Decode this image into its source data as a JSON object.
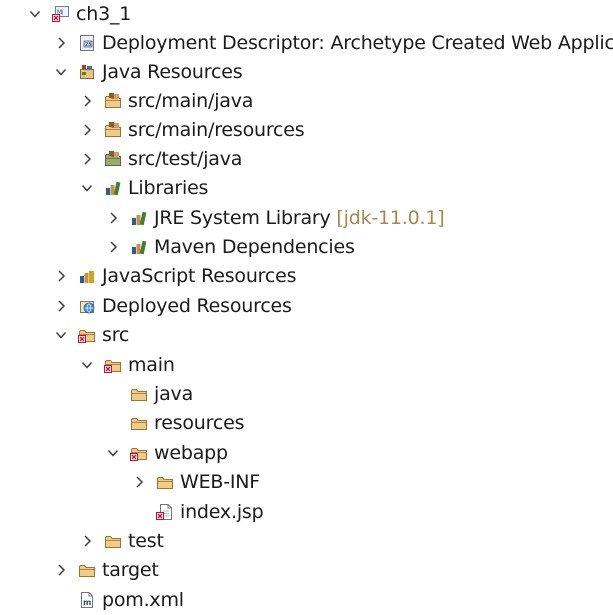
{
  "project_explorer": {
    "items": [
      {
        "label": "ch3_1",
        "suffix": "",
        "icon": "web-project-icon",
        "expanded": true
      },
      {
        "label": "Deployment Descriptor: Archetype Created Web Application",
        "suffix": "",
        "icon": "deployment-descriptor-icon",
        "expanded": false
      },
      {
        "label": "Java Resources",
        "suffix": "",
        "icon": "java-resources-icon",
        "expanded": true
      },
      {
        "label": "src/main/java",
        "suffix": "",
        "icon": "source-folder-icon",
        "expanded": false
      },
      {
        "label": "src/main/resources",
        "suffix": "",
        "icon": "source-folder-icon",
        "expanded": false
      },
      {
        "label": "src/test/java",
        "suffix": "",
        "icon": "test-source-folder-icon",
        "expanded": false
      },
      {
        "label": "Libraries",
        "suffix": "",
        "icon": "libraries-icon",
        "expanded": true
      },
      {
        "label": "JRE System Library",
        "suffix": "[jdk-11.0.1]",
        "icon": "library-icon",
        "expanded": false
      },
      {
        "label": "Maven Dependencies",
        "suffix": "",
        "icon": "library-icon",
        "expanded": false
      },
      {
        "label": "JavaScript Resources",
        "suffix": "",
        "icon": "javascript-resources-icon",
        "expanded": false
      },
      {
        "label": "Deployed Resources",
        "suffix": "",
        "icon": "deployed-resources-icon",
        "expanded": false
      },
      {
        "label": "src",
        "suffix": "",
        "icon": "folder-error-icon",
        "expanded": true
      },
      {
        "label": "main",
        "suffix": "",
        "icon": "folder-error-icon",
        "expanded": true
      },
      {
        "label": "java",
        "suffix": "",
        "icon": "folder-icon",
        "expanded": null
      },
      {
        "label": "resources",
        "suffix": "",
        "icon": "folder-icon",
        "expanded": null
      },
      {
        "label": "webapp",
        "suffix": "",
        "icon": "folder-error-icon",
        "expanded": true
      },
      {
        "label": "WEB-INF",
        "suffix": "",
        "icon": "folder-icon",
        "expanded": false
      },
      {
        "label": "index.jsp",
        "suffix": "",
        "icon": "jsp-file-error-icon",
        "expanded": null
      },
      {
        "label": "test",
        "suffix": "",
        "icon": "folder-icon",
        "expanded": false
      },
      {
        "label": "target",
        "suffix": "",
        "icon": "folder-icon",
        "expanded": false
      },
      {
        "label": "pom.xml",
        "suffix": "",
        "icon": "xml-file-icon",
        "expanded": null
      }
    ]
  }
}
